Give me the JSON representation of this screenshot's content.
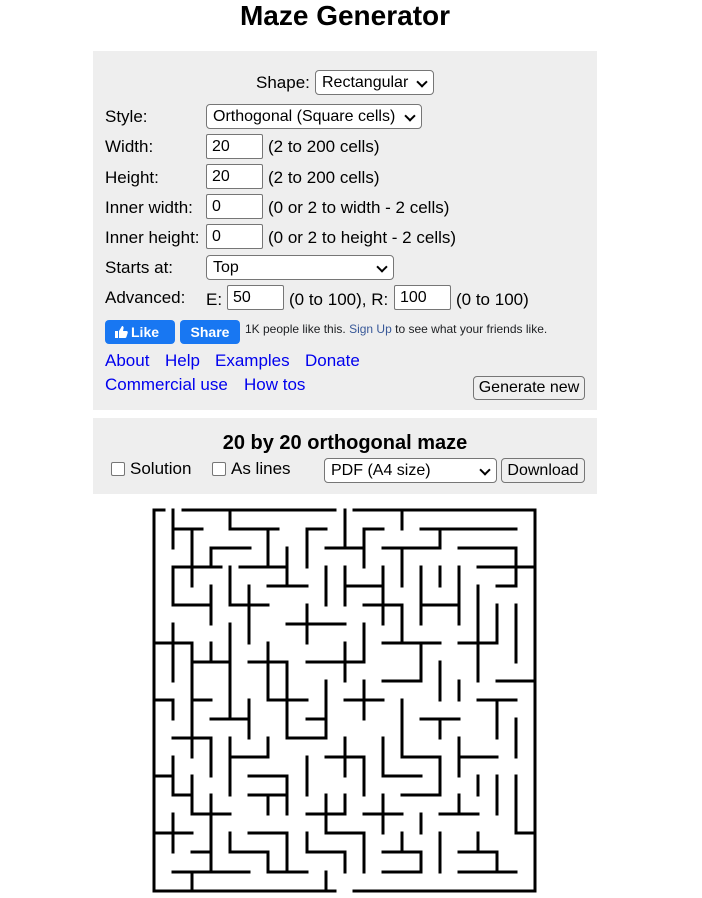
{
  "page": {
    "title": "Maze Generator"
  },
  "form": {
    "shape": {
      "label": "Shape:",
      "value": "Rectangular"
    },
    "style": {
      "label": "Style:",
      "value": "Orthogonal (Square cells)"
    },
    "width": {
      "label": "Width:",
      "value": "20",
      "hint": "(2 to 200 cells)"
    },
    "height": {
      "label": "Height:",
      "value": "20",
      "hint": "(2 to 200 cells)"
    },
    "inner_width": {
      "label": "Inner width:",
      "value": "0",
      "hint": "(0 or 2 to width - 2 cells)"
    },
    "inner_height": {
      "label": "Inner height:",
      "value": "0",
      "hint": "(0 or 2 to height - 2 cells)"
    },
    "starts_at": {
      "label": "Starts at:",
      "value": "Top"
    },
    "advanced": {
      "label": "Advanced:",
      "e_label": "E:",
      "e_value": "50",
      "e_hint": "(0 to 100), R:",
      "r_value": "100",
      "r_hint": "(0 to 100)"
    }
  },
  "social": {
    "like_label": "Like",
    "share_label": "Share",
    "text_prefix": "1K people like this.",
    "signup_label": "Sign Up",
    "text_suffix": "to see what your friends like."
  },
  "links": {
    "about": "About",
    "help": "Help",
    "examples": "Examples",
    "donate": "Donate",
    "commercial": "Commercial use",
    "howtos": "How tos"
  },
  "generate_label": "Generate new",
  "result": {
    "title": "20 by 20 orthogonal maze",
    "solution_label": "Solution",
    "solution_checked": false,
    "as_lines_label": "As lines",
    "as_lines_checked": false,
    "format_value": "PDF (A4 size)",
    "download_label": "Download"
  }
}
